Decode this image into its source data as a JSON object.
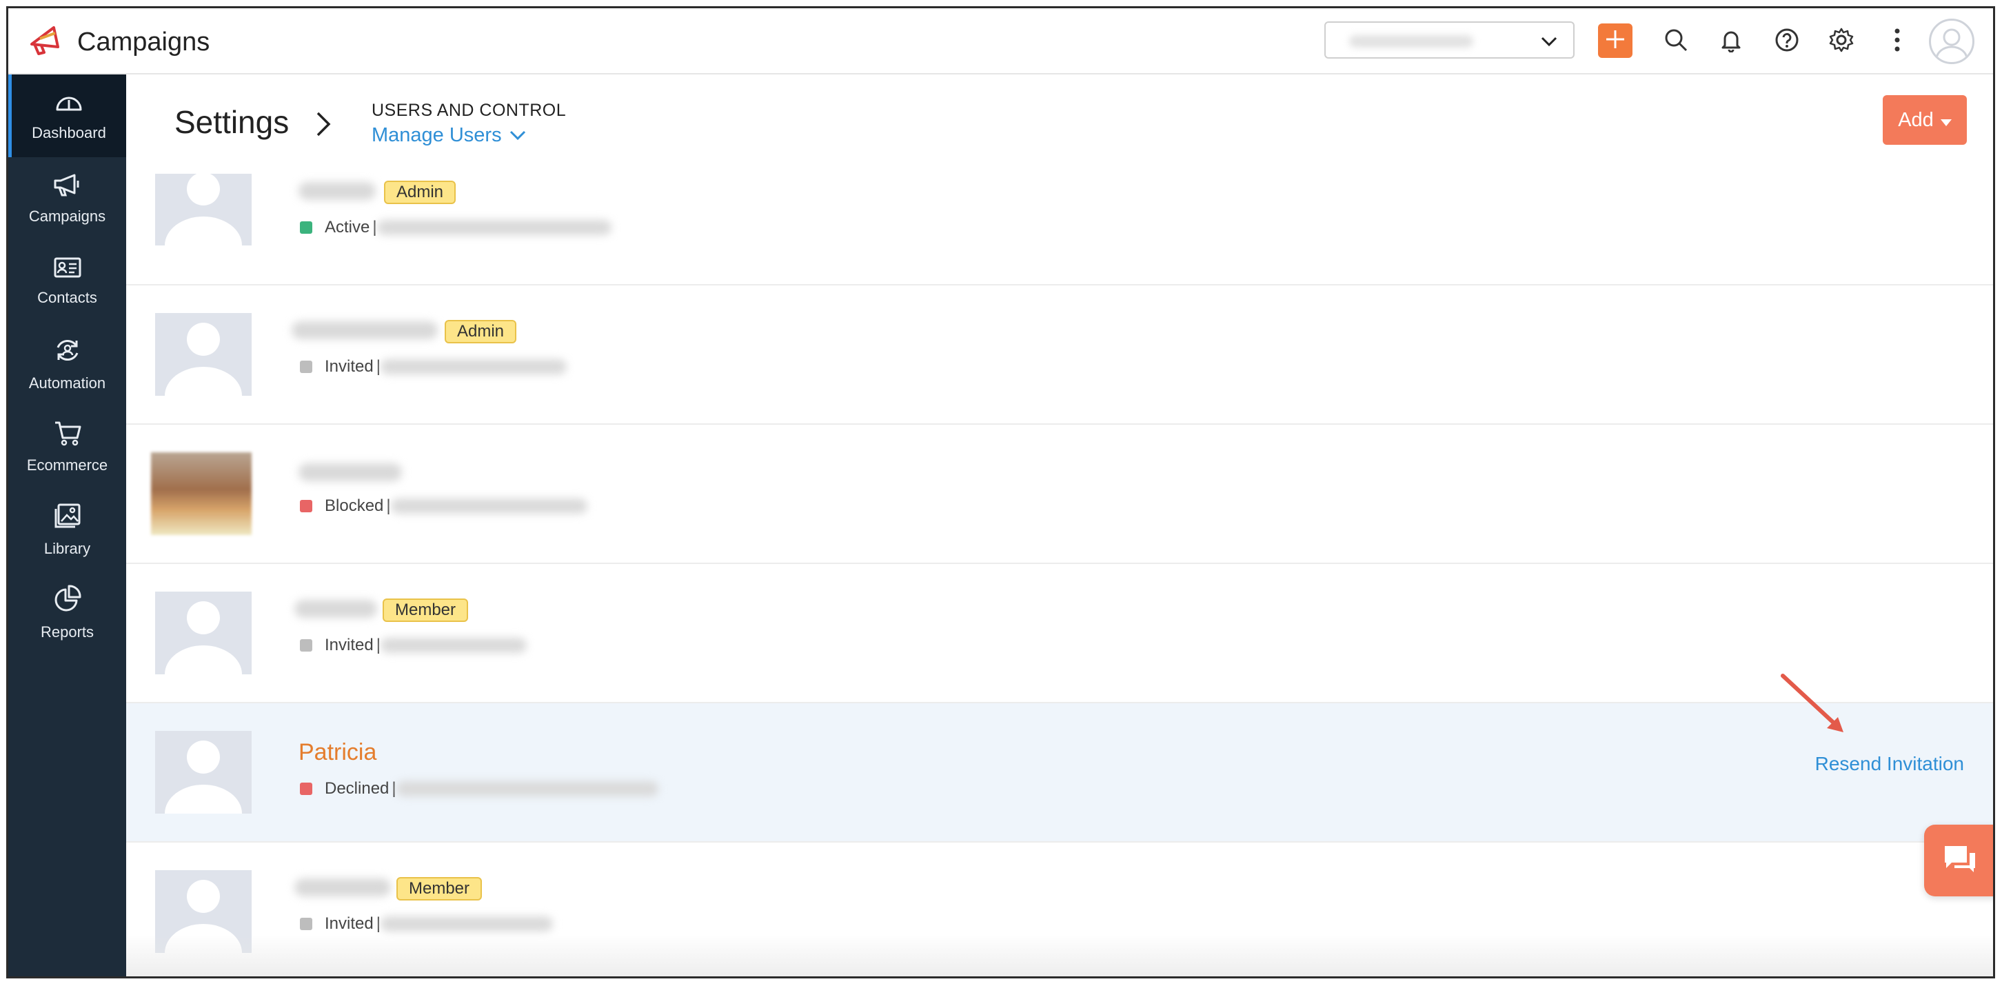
{
  "app": {
    "title": "Campaigns"
  },
  "topbar": {
    "account_selector": {
      "value": "",
      "icon": "chevron-down-icon"
    },
    "icons": [
      "plus-icon",
      "search-icon",
      "bell-icon",
      "help-icon",
      "gear-icon",
      "more-vertical-icon",
      "user-avatar"
    ]
  },
  "sidebar": {
    "items": [
      {
        "label": "Dashboard",
        "icon": "gauge-icon",
        "active": true
      },
      {
        "label": "Campaigns",
        "icon": "megaphone-icon",
        "active": false
      },
      {
        "label": "Contacts",
        "icon": "contact-card-icon",
        "active": false
      },
      {
        "label": "Automation",
        "icon": "automation-icon",
        "active": false
      },
      {
        "label": "Ecommerce",
        "icon": "cart-icon",
        "active": false
      },
      {
        "label": "Library",
        "icon": "image-library-icon",
        "active": false
      },
      {
        "label": "Reports",
        "icon": "pie-chart-icon",
        "active": false
      }
    ]
  },
  "header": {
    "title": "Settings",
    "section": "USERS AND CONTROL",
    "page": "Manage Users",
    "add_button": "Add"
  },
  "users": [
    {
      "name": "",
      "role": "Admin",
      "status": "Active",
      "status_color": "#3bb37d",
      "separator": "| "
    },
    {
      "name": "",
      "role": "Admin",
      "status": "Invited",
      "status_color": "#bdbdbd",
      "separator": "|"
    },
    {
      "name": "",
      "role": "",
      "status": "Blocked",
      "status_color": "#e86565",
      "separator": "| "
    },
    {
      "name": "",
      "role": "Member",
      "status": "Invited",
      "status_color": "#bdbdbd",
      "separator": "|"
    },
    {
      "name": "Patricia",
      "role": "",
      "status": "Declined",
      "status_color": "#e86565",
      "separator": "|",
      "action": "Resend Invitation"
    },
    {
      "name": "",
      "role": "Member",
      "status": "Invited",
      "status_color": "#bdbdbd",
      "separator": "|"
    }
  ],
  "colors": {
    "accent_orange": "#f37a5a",
    "link_blue": "#2f8fd6",
    "sidebar_bg": "#1d2c3a",
    "badge_yellow": "#fde589"
  },
  "chat": {
    "icon": "chat-icon"
  }
}
